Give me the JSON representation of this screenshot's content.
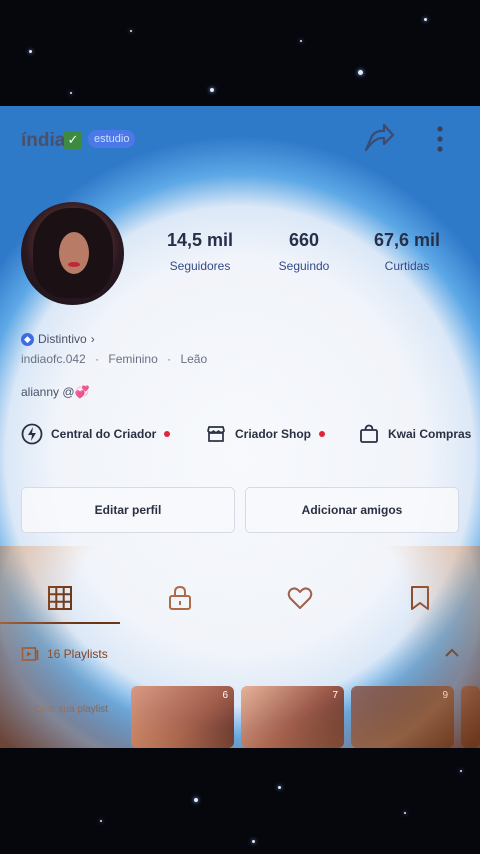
{
  "header": {
    "username": "índia",
    "badge_label": "estudio",
    "share_icon": "share-icon",
    "more_icon": "more-vertical-icon"
  },
  "stats": [
    {
      "value": "14,5 mil",
      "label": "Seguidores"
    },
    {
      "value": "660",
      "label": "Seguindo"
    },
    {
      "value": "67,6 mil",
      "label": "Curtidas"
    }
  ],
  "profile": {
    "distintivo": "Distintivo",
    "handle": "indiaofc.042",
    "gender": "Feminino",
    "sign": "Leão",
    "separator": "·",
    "bio": "alianny @💞"
  },
  "shortcuts": [
    {
      "label": "Central do Criador",
      "icon": "bolt-icon",
      "dot": true
    },
    {
      "label": "Criador Shop",
      "icon": "shop-icon",
      "dot": true
    },
    {
      "label": "Kwai Compras",
      "icon": "bag-icon",
      "dot": false
    }
  ],
  "buttons": {
    "edit": "Editar perfil",
    "add_friends": "Adicionar amigos"
  },
  "tabs": [
    "grid-icon",
    "lock-icon",
    "heart-icon",
    "bookmark-icon"
  ],
  "playlists": {
    "label": "16 Playlists",
    "create": "Criar sua playlist",
    "thumbs": [
      {
        "count": "6"
      },
      {
        "count": "7"
      },
      {
        "count": "9"
      }
    ]
  },
  "colors": {
    "accent": "#4c78e8",
    "notification": "#e3233a"
  }
}
